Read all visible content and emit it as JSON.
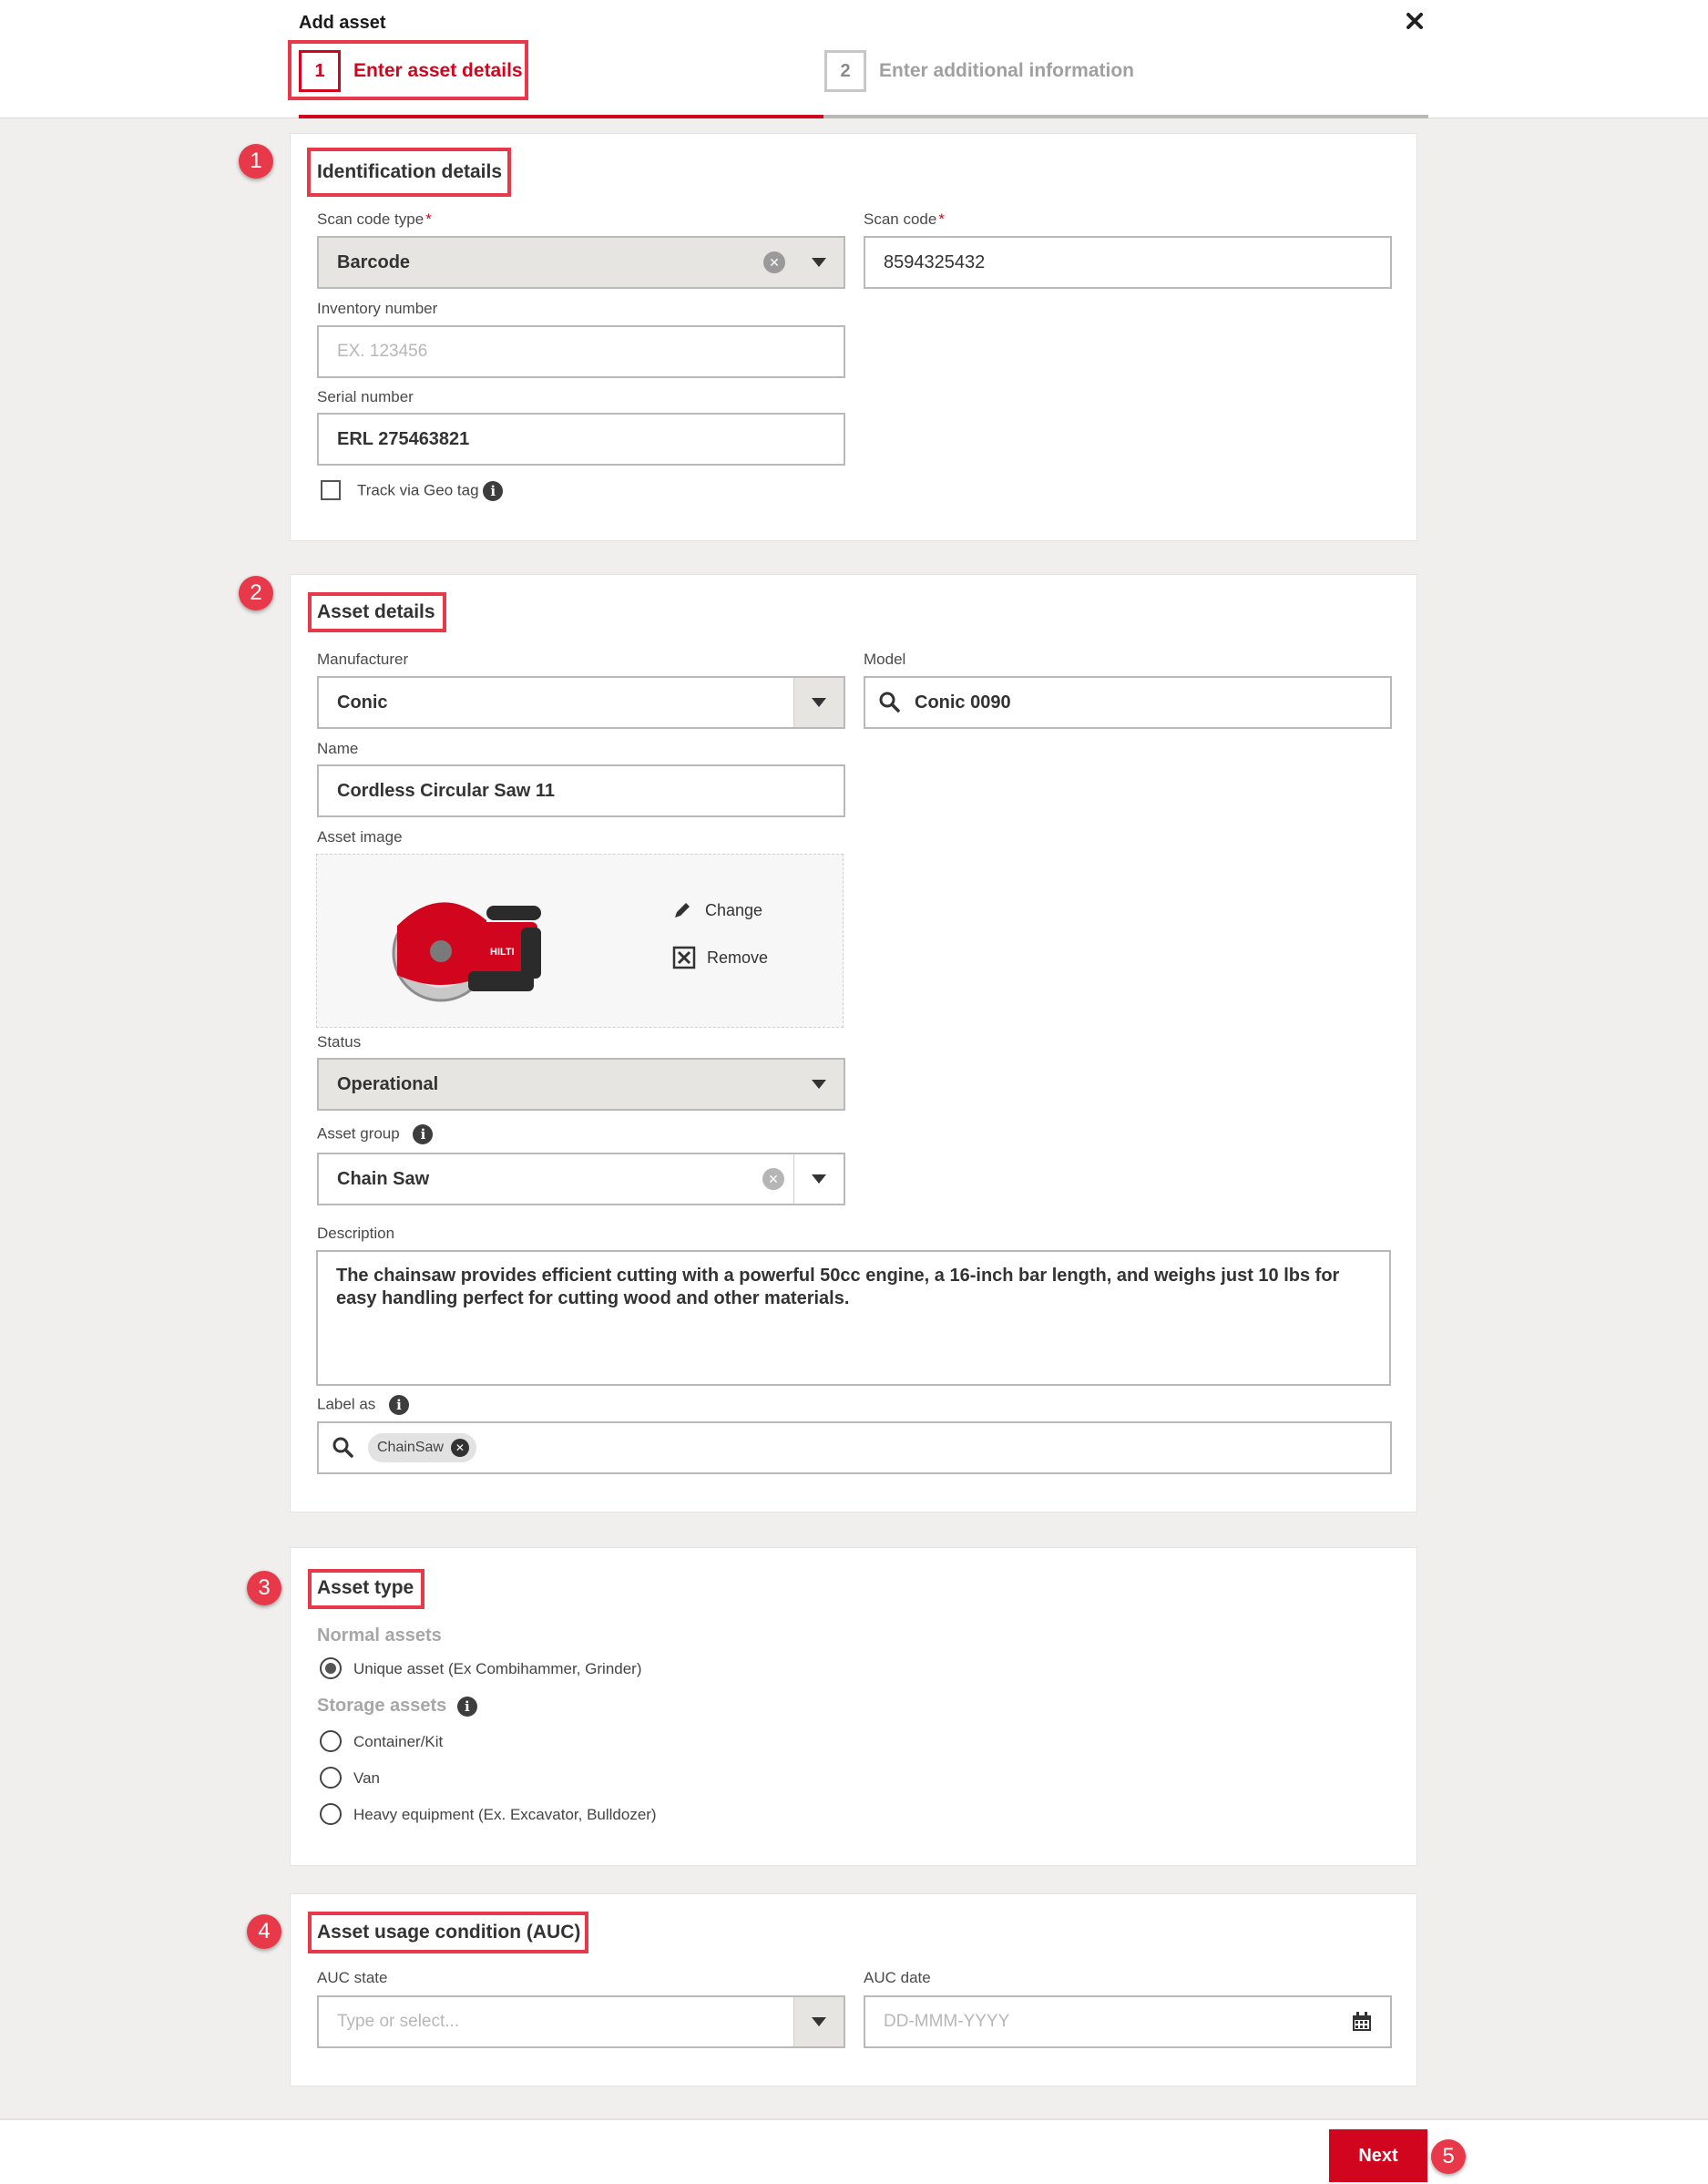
{
  "header": {
    "title": "Add asset",
    "steps": [
      {
        "number": "1",
        "label": "Enter asset details",
        "active": true
      },
      {
        "number": "2",
        "label": "Enter additional information",
        "active": false
      }
    ]
  },
  "markers": [
    "1",
    "2",
    "3",
    "4",
    "5"
  ],
  "identification": {
    "title": "Identification details",
    "scan_code_type": {
      "label": "Scan code type",
      "required": "*",
      "value": "Barcode"
    },
    "scan_code": {
      "label": "Scan code",
      "required": "*",
      "value": "8594325432"
    },
    "inventory_number": {
      "label": "Inventory number",
      "placeholder": "EX. 123456"
    },
    "serial_number": {
      "label": "Serial number",
      "value": "ERL 275463821"
    },
    "track_geo": {
      "label": "Track via Geo tag",
      "checked": false
    }
  },
  "asset_details": {
    "title": "Asset details",
    "manufacturer": {
      "label": "Manufacturer",
      "value": "Conic"
    },
    "model": {
      "label": "Model",
      "value": "Conic 0090"
    },
    "name": {
      "label": "Name",
      "value": "Cordless Circular Saw 11"
    },
    "asset_image": {
      "label": "Asset image",
      "change_label": "Change",
      "remove_label": "Remove",
      "brand_text": "HILTI"
    },
    "status": {
      "label": "Status",
      "value": "Operational"
    },
    "asset_group": {
      "label": "Asset group",
      "value": "Chain Saw"
    },
    "description": {
      "label": "Description",
      "value": "The chainsaw provides efficient cutting with a powerful 50cc engine, a 16-inch bar length, and weighs just 10 lbs for easy handling perfect for cutting wood and other materials."
    },
    "label_as": {
      "label": "Label as",
      "tags": [
        "ChainSaw"
      ]
    }
  },
  "asset_type": {
    "title": "Asset type",
    "normal_heading": "Normal assets",
    "normal_options": [
      {
        "label": "Unique asset (Ex Combihammer, Grinder)",
        "selected": true
      }
    ],
    "storage_heading": "Storage assets",
    "storage_options": [
      {
        "label": "Container/Kit",
        "selected": false
      },
      {
        "label": "Van",
        "selected": false
      },
      {
        "label": "Heavy equipment (Ex. Excavator, Bulldozer)",
        "selected": false
      }
    ]
  },
  "auc": {
    "title": "Asset usage condition (AUC)",
    "state": {
      "label": "AUC state",
      "placeholder": "Type or select..."
    },
    "date": {
      "label": "AUC date",
      "placeholder": "DD-MMM-YYYY"
    }
  },
  "footer": {
    "next_label": "Next"
  },
  "colors": {
    "accent": "#d2051e",
    "annotation": "#e8394a",
    "page_bg": "#f0efed"
  },
  "icons": [
    "close-icon",
    "clear-icon",
    "chevron-down-icon",
    "info-icon",
    "search-icon",
    "pencil-icon",
    "remove-box-icon",
    "calendar-icon"
  ]
}
